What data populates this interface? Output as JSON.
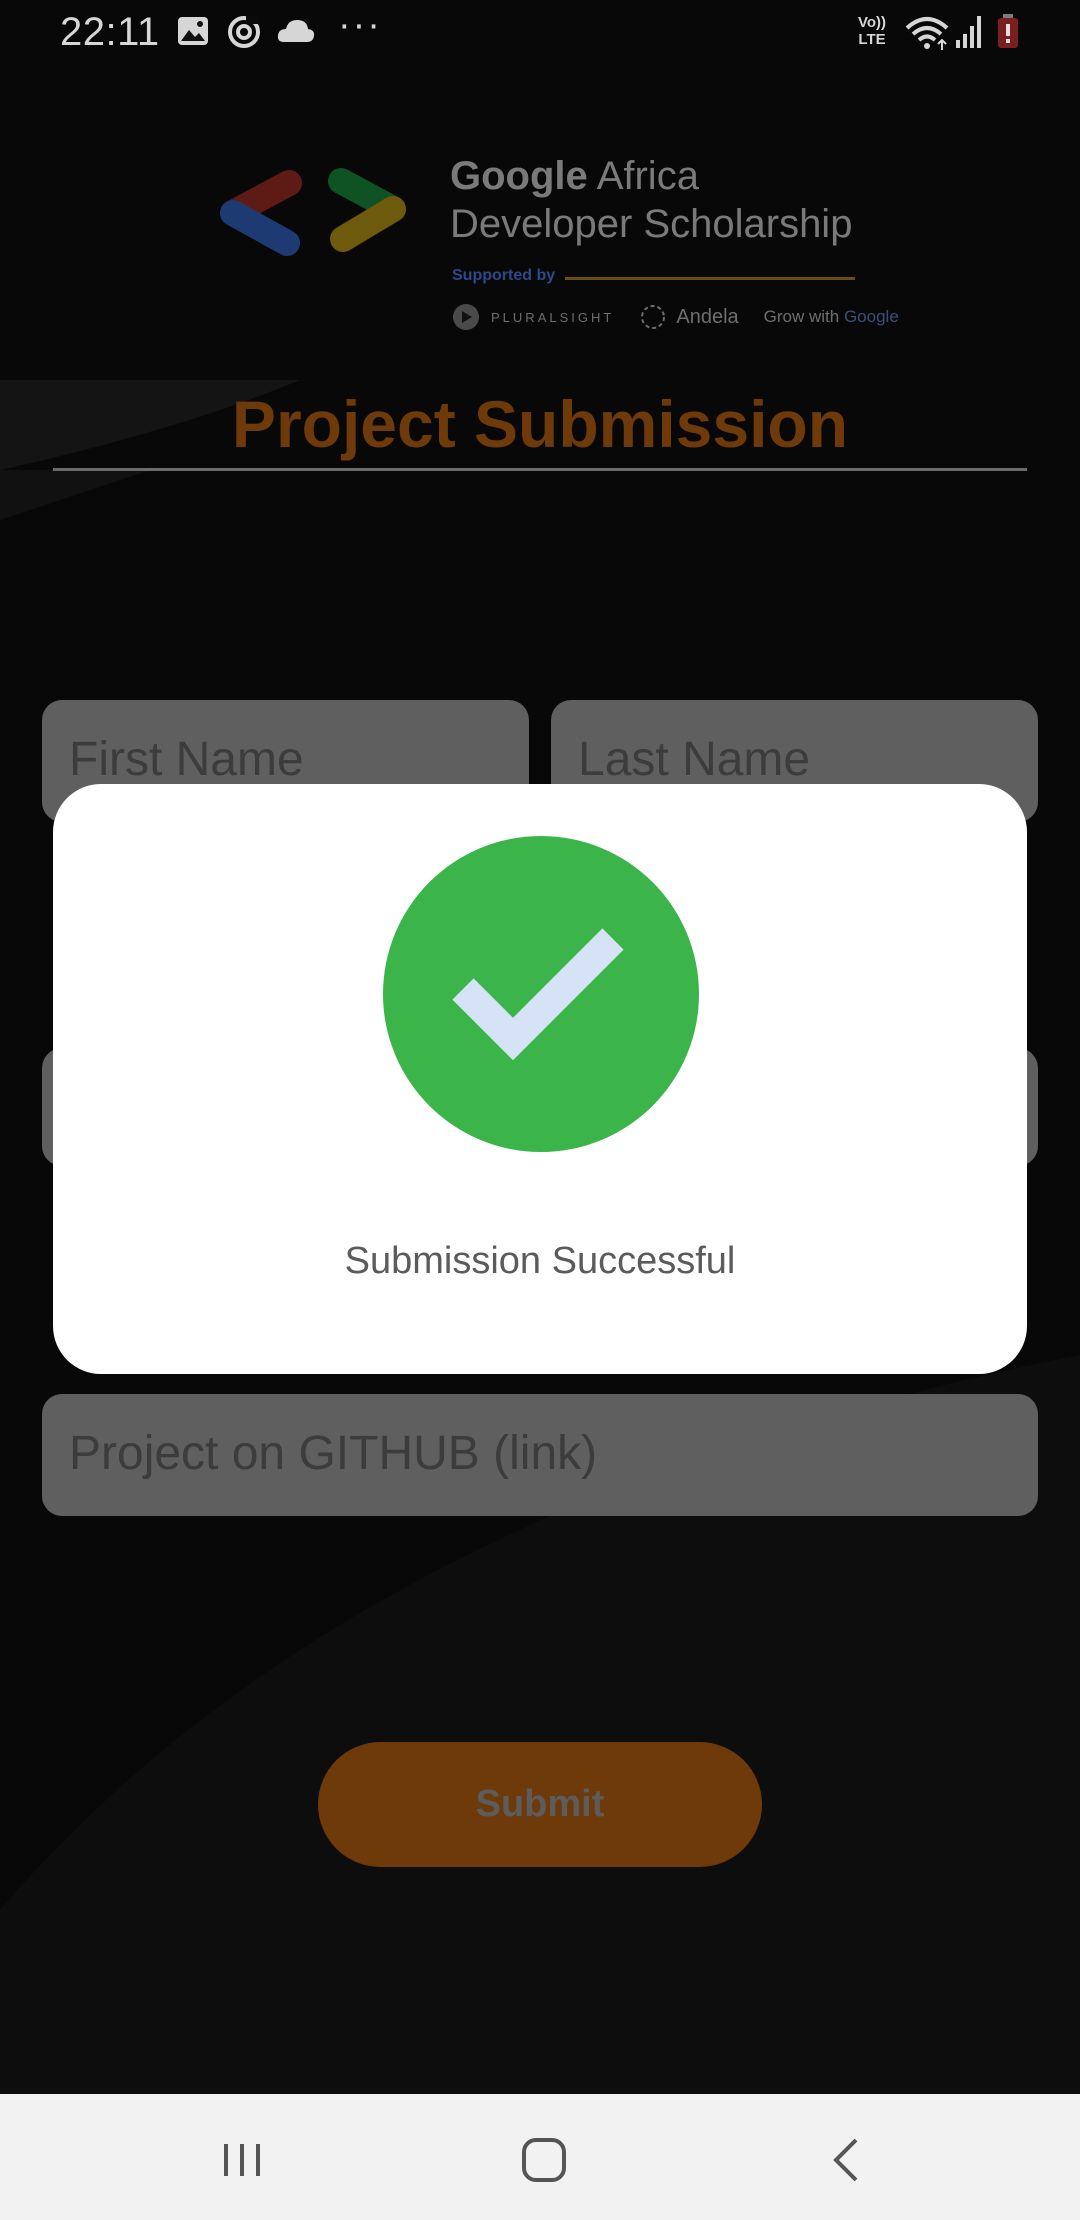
{
  "status_bar": {
    "time": "22:11",
    "icons": [
      "gallery-icon",
      "sync-icon",
      "cloud-icon",
      "more-dots",
      "volte-lte",
      "wifi-icon",
      "signal-icon",
      "battery-icon"
    ],
    "more": "···",
    "volte": "Vo))",
    "lte": "LTE"
  },
  "header": {
    "brand_word": "Google",
    "brand_rest": " Africa",
    "brand_line2": "Developer Scholarship",
    "supported_by": "Supported by",
    "sponsors": [
      "PLURALSIGHT",
      "Andela",
      "Grow with ",
      "Google"
    ],
    "page_title": "Project Submission"
  },
  "form": {
    "first_name_placeholder": "First Name",
    "last_name_placeholder": "Last Name",
    "github_placeholder": "Project on GITHUB (link)",
    "submit_label": "Submit"
  },
  "dialog": {
    "message": "Submission Successful",
    "icon": "check-circle-icon",
    "colors": {
      "circle": "#3bb54a",
      "check": "#d6e2f5"
    }
  },
  "nav": {
    "icons": [
      "recent-apps-icon",
      "home-icon",
      "back-icon"
    ]
  },
  "colors": {
    "accent": "#e57c13",
    "overlay_dim": "rgba(0,0,0,0.55)"
  }
}
